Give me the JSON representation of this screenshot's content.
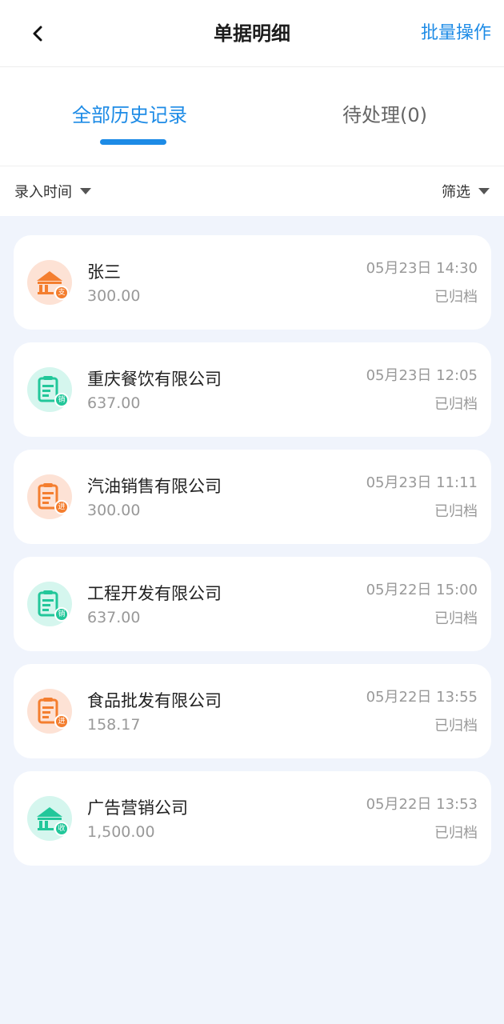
{
  "header": {
    "title": "单据明细",
    "batch_label": "批量操作",
    "back_icon": "chevron-left-icon"
  },
  "tabs": [
    {
      "label": "全部历史记录",
      "active": true
    },
    {
      "label": "待处理(0)",
      "active": false
    }
  ],
  "filters": {
    "sort_label": "录入时间",
    "filter_label": "筛选"
  },
  "colors": {
    "accent": "#1d8be6",
    "orange": "#f47e2f",
    "green": "#22c79a",
    "background": "#f0f4fc"
  },
  "records": [
    {
      "name": "张三",
      "amount": "300.00",
      "time": "05月23日 14:30",
      "status": "已归档",
      "icon": "bank-icon",
      "badge": "支",
      "color": "orange"
    },
    {
      "name": "重庆餐饮有限公司",
      "amount": "637.00",
      "time": "05月23日 12:05",
      "status": "已归档",
      "icon": "invoice-icon",
      "badge": "销",
      "color": "green"
    },
    {
      "name": "汽油销售有限公司",
      "amount": "300.00",
      "time": "05月23日 11:11",
      "status": "已归档",
      "icon": "invoice-icon",
      "badge": "进",
      "color": "orange"
    },
    {
      "name": "工程开发有限公司",
      "amount": "637.00",
      "time": "05月22日 15:00",
      "status": "已归档",
      "icon": "invoice-icon",
      "badge": "销",
      "color": "green"
    },
    {
      "name": "食品批发有限公司",
      "amount": "158.17",
      "time": "05月22日 13:55",
      "status": "已归档",
      "icon": "invoice-icon",
      "badge": "进",
      "color": "orange"
    },
    {
      "name": "广告营销公司",
      "amount": "1,500.00",
      "time": "05月22日 13:53",
      "status": "已归档",
      "icon": "bank-icon",
      "badge": "收",
      "color": "green"
    }
  ]
}
